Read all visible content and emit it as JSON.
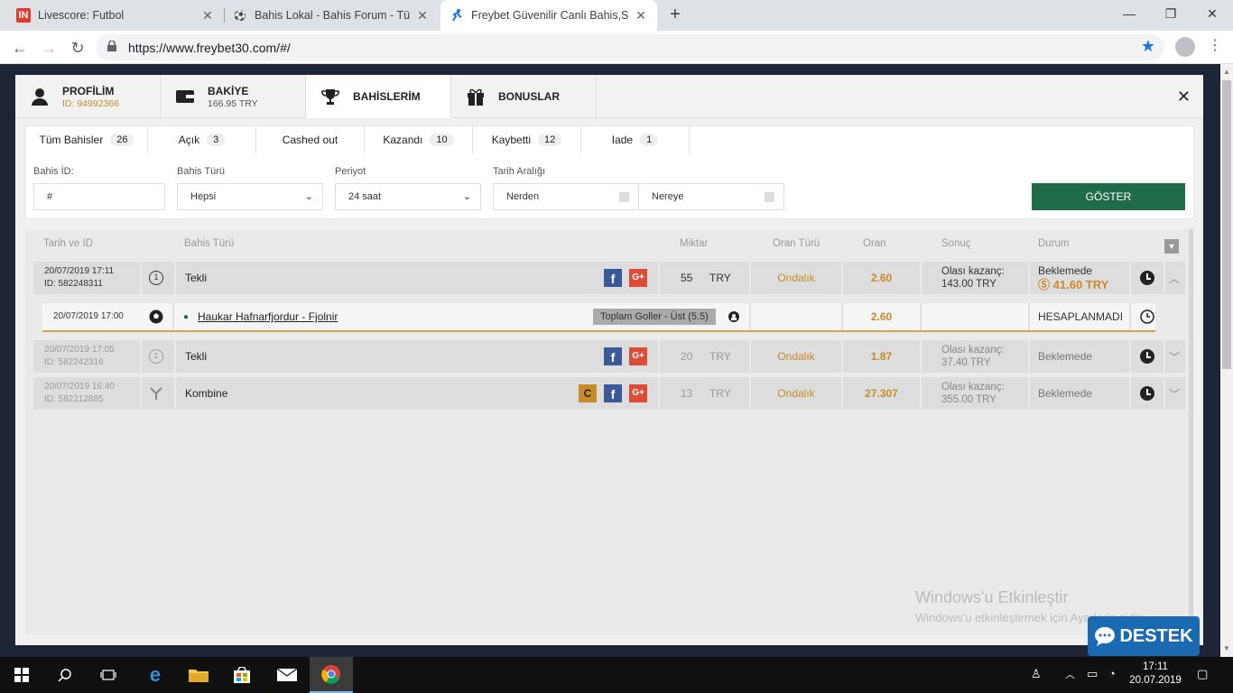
{
  "browser": {
    "tabs": [
      {
        "title": "Livescore: Futbol",
        "icon": "IN"
      },
      {
        "title": "Bahis Lokal - Bahis Forum - Türki",
        "icon": "⚽"
      },
      {
        "title": "Freybet Güvenilir Canlı Bahis,Slot",
        "icon": "runner"
      }
    ],
    "url": "https://www.freybet30.com/#/"
  },
  "modal": {
    "tabs": [
      {
        "label": "PROFİLİM",
        "sub": "ID: 94992366"
      },
      {
        "label": "BAKİYE",
        "sub": "166.95 TRY"
      },
      {
        "label": "BAHİSLERİM",
        "sub": ""
      },
      {
        "label": "BONUSLAR",
        "sub": ""
      }
    ]
  },
  "filters": {
    "subtabs": [
      {
        "label": "Tüm Bahisler",
        "count": "26"
      },
      {
        "label": "Açık",
        "count": "3"
      },
      {
        "label": "Cashed out",
        "count": ""
      },
      {
        "label": "Kazandı",
        "count": "10"
      },
      {
        "label": "Kaybetti",
        "count": "12"
      },
      {
        "label": "Iade",
        "count": "1"
      }
    ],
    "bet_id_label": "Bahis İD:",
    "bet_id_value": "#",
    "bet_type_label": "Bahis Türü",
    "bet_type_value": "Hepsi",
    "period_label": "Periyot",
    "period_value": "24 saat",
    "date_range_label": "Tarih Aralığı",
    "from_placeholder": "Nerden",
    "to_placeholder": "Nereye",
    "show_button": "GÖSTER"
  },
  "table": {
    "headers": [
      "Tarih ve ID",
      "Bahis Türü",
      "Miktar",
      "Oran Türü",
      "Oran",
      "Sonuç",
      "Durum"
    ],
    "rows": [
      {
        "date": "20/07/2019 17:11",
        "id": "ID: 582248311",
        "badge": "1",
        "type": "Tekli",
        "amount": "55",
        "currency": "TRY",
        "odds_type": "Ondalık",
        "odds": "2.60",
        "result_label": "Olası kazanç:",
        "result_value": "143.00 TRY",
        "status": "Beklemede",
        "cashout": "41.60 TRY"
      },
      {
        "date": "20/07/2019 17:05",
        "id": "ID: 582242316",
        "badge": "1",
        "type": "Tekli",
        "amount": "20",
        "currency": "TRY",
        "odds_type": "Ondalık",
        "odds": "1.87",
        "result_label": "Olası kazanç:",
        "result_value": "37.40 TRY",
        "status": "Beklemede"
      },
      {
        "date": "20/07/2019 16:40",
        "id": "ID: 582212885",
        "badge": "",
        "type": "Kombine",
        "amount": "13",
        "currency": "TRY",
        "odds_type": "Ondalık",
        "odds": "27.307",
        "result_label": "Olası kazanç:",
        "result_value": "355.00 TRY",
        "status": "Beklemede"
      }
    ],
    "selection": {
      "date": "20/07/2019 17:00",
      "event": "Haukar Hafnarfjordur - Fjolnir",
      "market": "Toplam Goller - Üst (5.5)",
      "odds": "2.60",
      "status": "HESAPLANMADI"
    }
  },
  "watermark": {
    "line1": "Windows'u Etkinleştir",
    "line2": "Windows'u etkinleştirmek için Ayarlar'a gidin."
  },
  "support": "DESTEK",
  "taskbar": {
    "time": "17:11",
    "date": "20.07.2019"
  }
}
